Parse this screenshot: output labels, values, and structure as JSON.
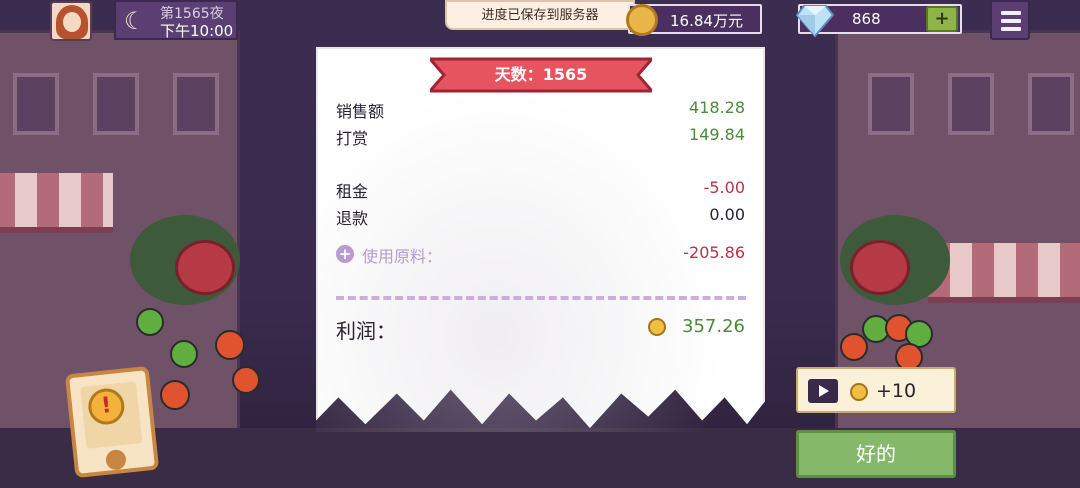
{
  "hud": {
    "night_label": "第1565夜",
    "time_label": "下午10:00",
    "save_toast": "进度已保存到服务器",
    "coins": "16.84万元",
    "gems": "868",
    "gem_add": "+"
  },
  "receipt": {
    "day_title": "天数：1565",
    "rows": [
      {
        "label": "销售额",
        "value": "418.28"
      },
      {
        "label": "打赏",
        "value": "149.84"
      },
      {
        "label": "租金",
        "value": "-5.00"
      },
      {
        "label": "退款",
        "value": "0.00"
      }
    ],
    "materials_label": "使用原料：",
    "materials_value": "-205.86",
    "profit_label": "利润：",
    "profit_value": "357.26"
  },
  "actions": {
    "ad_reward": "+10",
    "ok_label": "好的"
  },
  "colors": {
    "positive": "#4b8b3a",
    "negative": "#b5324a",
    "ribbon": "#e5545f",
    "ok_button": "#86b86a"
  }
}
